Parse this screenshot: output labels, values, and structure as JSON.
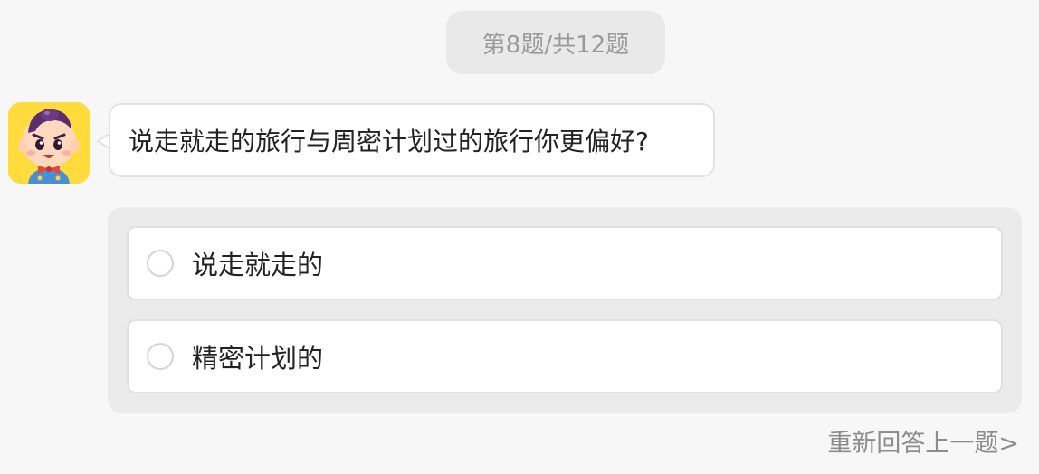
{
  "progress": {
    "label": "第8题/共12题"
  },
  "question": {
    "text": "说走就走的旅行与周密计划过的旅行你更偏好?"
  },
  "options": [
    {
      "label": "说走就走的"
    },
    {
      "label": "精密计划的"
    }
  ],
  "footer": {
    "back_label": "重新回答上一题>"
  },
  "colors": {
    "page_bg": "#f7f7f7",
    "avatar_bg": "#ffdb3d",
    "muted_text": "#9a9a9a",
    "text": "#222222"
  },
  "icons": {
    "avatar": "cartoon-boy-avatar-icon",
    "radio": "radio-circle-icon"
  }
}
